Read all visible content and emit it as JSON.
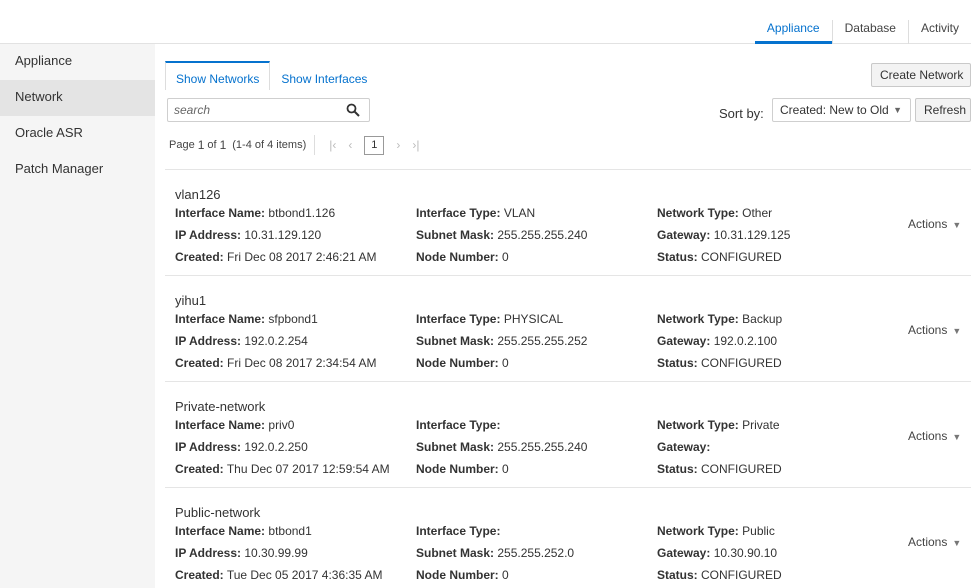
{
  "top_tabs": [
    "Appliance",
    "Database",
    "Activity"
  ],
  "sidebar": [
    "Appliance",
    "Network",
    "Oracle ASR",
    "Patch Manager"
  ],
  "subtabs": [
    "Show Networks",
    "Show Interfaces"
  ],
  "buttons": {
    "create": "Create Network",
    "refresh": "Refresh"
  },
  "search": {
    "placeholder": "search"
  },
  "sort": {
    "label": "Sort by:",
    "value": "Created: New to Old"
  },
  "pager": {
    "page_word": "Page",
    "current": "1",
    "of_word": "of",
    "total": "1",
    "range": "(1-4 of 4 items)",
    "page_box": "1"
  },
  "labels": {
    "interface_name": "Interface Name:",
    "ip_address": "IP Address:",
    "created": "Created:",
    "interface_type": "Interface Type:",
    "subnet_mask": "Subnet Mask:",
    "node_number": "Node Number:",
    "network_type": "Network Type:",
    "gateway": "Gateway:",
    "status": "Status:",
    "actions": "Actions"
  },
  "networks": [
    {
      "name": "vlan126",
      "interface_name": "btbond1.126",
      "ip_address": "10.31.129.120",
      "created": "Fri Dec 08 2017 2:46:21 AM",
      "interface_type": "VLAN",
      "subnet_mask": "255.255.255.240",
      "node_number": "0",
      "network_type": "Other",
      "gateway": "10.31.129.125",
      "status": "CONFIGURED"
    },
    {
      "name": "yihu1",
      "interface_name": "sfpbond1",
      "ip_address": "192.0.2.254",
      "created": "Fri Dec 08 2017 2:34:54 AM",
      "interface_type": "PHYSICAL",
      "subnet_mask": "255.255.255.252",
      "node_number": "0",
      "network_type": "Backup",
      "gateway": "192.0.2.100",
      "status": "CONFIGURED"
    },
    {
      "name": "Private-network",
      "interface_name": "priv0",
      "ip_address": "192.0.2.250",
      "created": "Thu Dec 07 2017 12:59:54 AM",
      "interface_type": "",
      "subnet_mask": "255.255.255.240",
      "node_number": "0",
      "network_type": "Private",
      "gateway": "",
      "status": "CONFIGURED"
    },
    {
      "name": "Public-network",
      "interface_name": "btbond1",
      "ip_address": "10.30.99.99",
      "created": "Tue Dec 05 2017 4:36:35 AM",
      "interface_type": "",
      "subnet_mask": "255.255.252.0",
      "node_number": "0",
      "network_type": "Public",
      "gateway": "10.30.90.10",
      "status": "CONFIGURED"
    }
  ]
}
